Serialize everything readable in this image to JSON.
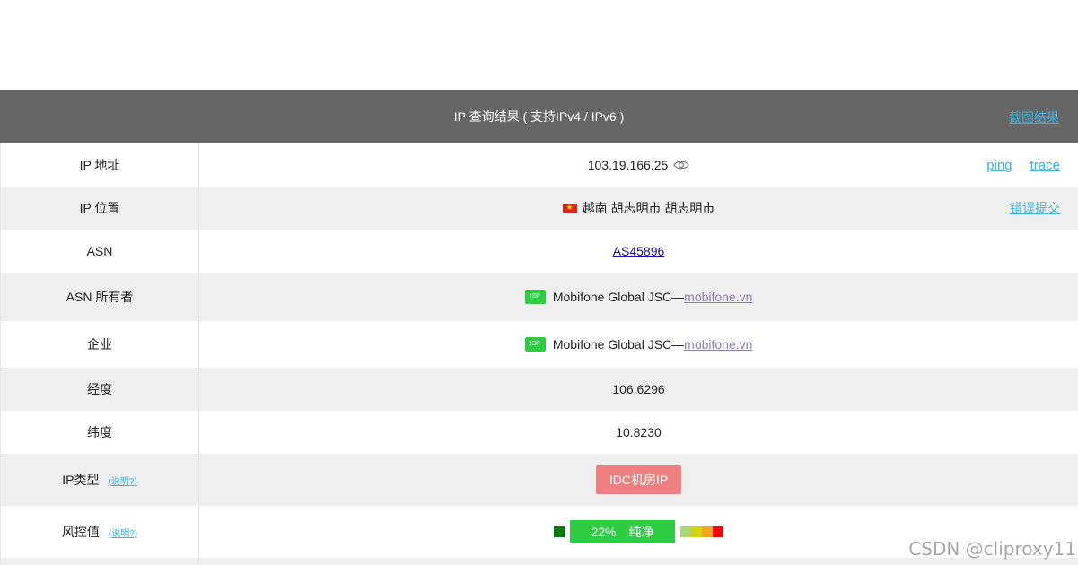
{
  "header": {
    "title": "IP 查询结果 ( 支持IPv4 / IPv6 )",
    "screenshot_link": "截图结果"
  },
  "rows": {
    "ip_address": {
      "label": "IP 地址",
      "value": "103.19.166.25",
      "ping": "ping",
      "trace": "trace"
    },
    "ip_location": {
      "label": "IP 位置",
      "value": "越南 胡志明市 胡志明市",
      "report": "错误提交"
    },
    "asn": {
      "label": "ASN",
      "value": "AS45896"
    },
    "asn_owner": {
      "label": "ASN 所有者",
      "badge": "ISP",
      "name": "Mobifone Global JSC—",
      "domain": "mobifone.vn"
    },
    "company": {
      "label": "企业",
      "badge": "ISP",
      "name": "Mobifone Global JSC—",
      "domain": "mobifone.vn"
    },
    "longitude": {
      "label": "经度",
      "value": "106.6296"
    },
    "latitude": {
      "label": "纬度",
      "value": "10.8230"
    },
    "ip_type": {
      "label": "IP类型",
      "explain": "(说明?)",
      "value": "IDC机房IP"
    },
    "risk": {
      "label": "风控值",
      "explain": "(说明?)",
      "percent": "22%",
      "status": "纯净",
      "level": 0.22
    }
  },
  "colors": {
    "header_bg": "#666666",
    "link": "#33b5e5",
    "isp_badge": "#2ecc40",
    "type_badge": "#f08080",
    "risk_bar": "#2ecc40",
    "risk_scale": [
      "#a8d86e",
      "#d4d40e",
      "#f5a623",
      "#ff0000"
    ]
  },
  "watermark": "CSDN @cliproxy11"
}
